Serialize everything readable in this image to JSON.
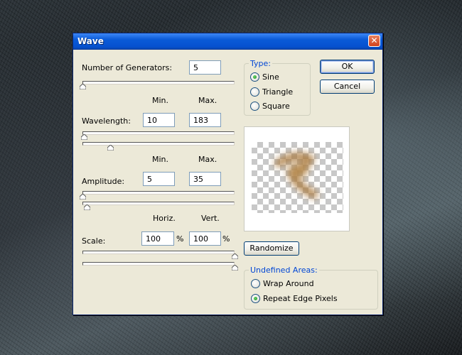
{
  "dialog": {
    "title": "Wave",
    "close_glyph": "✕",
    "generators": {
      "label": "Number of Generators:",
      "value": "5",
      "slider_fraction": 0.0
    },
    "headers": {
      "min": "Min.",
      "max": "Max.",
      "horiz": "Horiz.",
      "vert": "Vert."
    },
    "wavelength": {
      "label": "Wavelength:",
      "min": "10",
      "max": "183",
      "min_fraction": 0.01,
      "max_fraction": 0.18
    },
    "amplitude": {
      "label": "Amplitude:",
      "min": "5",
      "max": "35",
      "min_fraction": 0.0,
      "max_fraction": 0.03
    },
    "scale": {
      "label": "Scale:",
      "horiz": "100",
      "vert": "100",
      "percent": "%",
      "horiz_fraction": 1.0,
      "vert_fraction": 1.0
    },
    "type": {
      "title": "Type:",
      "options": [
        {
          "label": "Sine",
          "selected": true
        },
        {
          "label": "Triangle",
          "selected": false
        },
        {
          "label": "Square",
          "selected": false
        }
      ]
    },
    "buttons": {
      "ok": "OK",
      "cancel": "Cancel",
      "randomize": "Randomize"
    },
    "undefined_areas": {
      "title": "Undefined Areas:",
      "options": [
        {
          "label": "Wrap Around",
          "selected": false
        },
        {
          "label": "Repeat Edge Pixels",
          "selected": true
        }
      ]
    },
    "colors": {
      "titlebar": "#0651cf",
      "dialog_bg": "#ece9d8",
      "group_title": "#0046d5",
      "preview_stroke": "#a9783a"
    }
  }
}
